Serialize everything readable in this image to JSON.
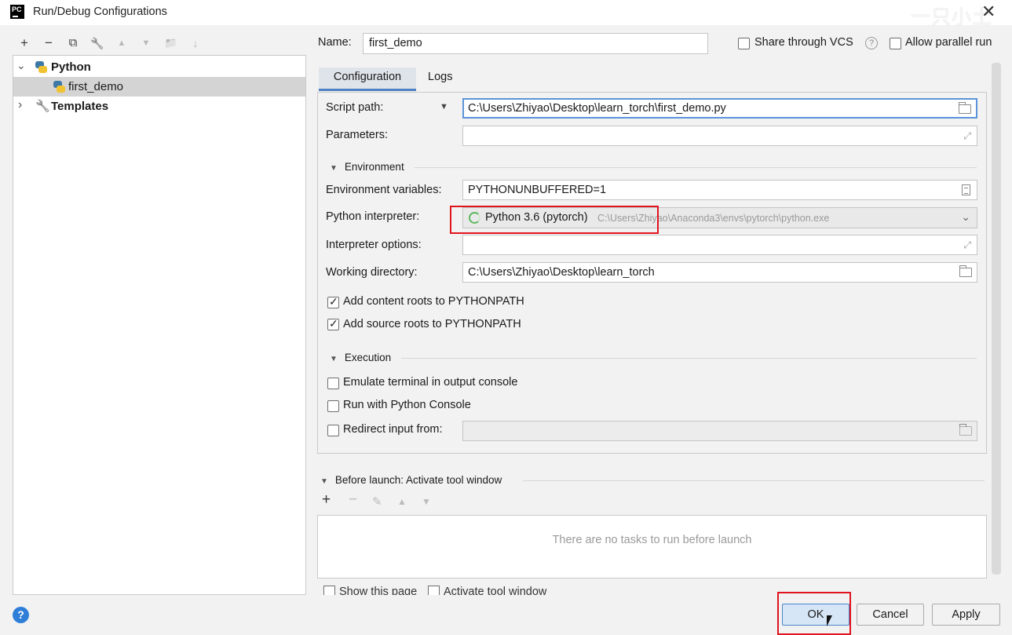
{
  "window": {
    "title": "Run/Debug Configurations",
    "app_logo": "PC",
    "watermark": "一只小土",
    "close_glyph": "✕"
  },
  "toolbar": {
    "icons": [
      "add-icon",
      "remove-icon",
      "copy-icon",
      "wrench-icon",
      "move-up-icon",
      "move-down-icon",
      "folder-add-icon",
      "sort-icon"
    ],
    "glyphs": [
      "+",
      "−",
      "⧉",
      "🔧",
      "▲",
      "▼",
      "📁",
      "↓"
    ]
  },
  "tree": {
    "python_label": "Python",
    "first_demo_label": "first_demo",
    "templates_label": "Templates",
    "expanded_glyph": "⌄",
    "collapsed_glyph": "›"
  },
  "header": {
    "name_label": "Name:",
    "name_value": "first_demo",
    "share_vcs_label": "Share through VCS",
    "help_glyph": "?",
    "allow_parallel_label": "Allow parallel run"
  },
  "tabs": {
    "configuration": "Configuration",
    "logs": "Logs"
  },
  "form": {
    "script_path_label": "Script path:",
    "script_path_value": "C:\\Users\\Zhiyao\\Desktop\\learn_torch\\first_demo.py",
    "parameters_label": "Parameters:",
    "parameters_value": "",
    "environment_section": "Environment",
    "env_vars_label": "Environment variables:",
    "env_vars_value": "PYTHONUNBUFFERED=1",
    "interpreter_label": "Python interpreter:",
    "interpreter_name": "Python 3.6 (pytorch)",
    "interpreter_path": "C:\\Users\\Zhiyao\\Anaconda3\\envs\\pytorch\\python.exe",
    "interpreter_options_label": "Interpreter options:",
    "interpreter_options_value": "",
    "working_dir_label": "Working directory:",
    "working_dir_value": "C:\\Users\\Zhiyao\\Desktop\\learn_torch",
    "add_content_roots": "Add content roots to PYTHONPATH",
    "add_content_roots_checked": true,
    "add_source_roots": "Add source roots to PYTHONPATH",
    "add_source_roots_checked": true,
    "execution_section": "Execution",
    "emulate_terminal": "Emulate terminal in output console",
    "emulate_terminal_checked": false,
    "run_python_console": "Run with Python Console",
    "run_python_console_checked": false,
    "redirect_input": "Redirect input from:",
    "redirect_input_checked": false,
    "redirect_input_value": ""
  },
  "before_launch": {
    "header": "Before launch: Activate tool window",
    "empty_text": "There are no tasks to run before launch",
    "cut_left": "Show this page",
    "cut_right": "Activate tool window"
  },
  "buttons": {
    "help": "?",
    "ok": "OK",
    "cancel": "Cancel",
    "apply": "Apply"
  },
  "colors": {
    "accent": "#4f82c2",
    "highlight_box": "#e0141e",
    "selection": "#d4d4d4"
  }
}
